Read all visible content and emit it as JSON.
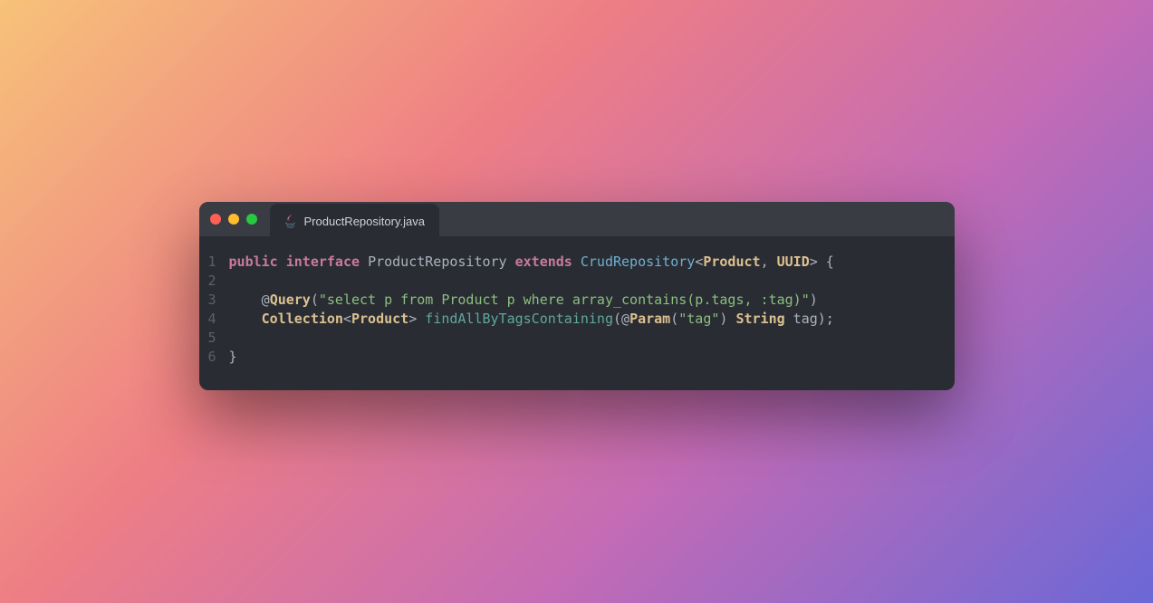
{
  "tab": {
    "filename": "ProductRepository.java"
  },
  "gutter": [
    "1",
    "2",
    "3",
    "4",
    "5",
    "6"
  ],
  "code": {
    "lines": [
      [
        {
          "c": "kw",
          "t": "public"
        },
        {
          "c": "p",
          "t": " "
        },
        {
          "c": "kw",
          "t": "interface"
        },
        {
          "c": "p",
          "t": " "
        },
        {
          "c": "p",
          "t": "ProductRepository "
        },
        {
          "c": "kw",
          "t": "extends"
        },
        {
          "c": "p",
          "t": " "
        },
        {
          "c": "cls",
          "t": "CrudRepository"
        },
        {
          "c": "p",
          "t": "<"
        },
        {
          "c": "typ",
          "t": "Product"
        },
        {
          "c": "p",
          "t": ", "
        },
        {
          "c": "typ",
          "t": "UUID"
        },
        {
          "c": "p",
          "t": "> {"
        }
      ],
      [],
      [
        {
          "c": "p",
          "t": "    @"
        },
        {
          "c": "ann",
          "t": "Query"
        },
        {
          "c": "p",
          "t": "("
        },
        {
          "c": "str",
          "t": "\"select p from Product p where array_contains(p.tags, :tag)\""
        },
        {
          "c": "p",
          "t": ")"
        }
      ],
      [
        {
          "c": "p",
          "t": "    "
        },
        {
          "c": "typ",
          "t": "Collection"
        },
        {
          "c": "p",
          "t": "<"
        },
        {
          "c": "typ",
          "t": "Product"
        },
        {
          "c": "p",
          "t": "> "
        },
        {
          "c": "fn",
          "t": "findAllByTagsContaining"
        },
        {
          "c": "p",
          "t": "(@"
        },
        {
          "c": "ann",
          "t": "Param"
        },
        {
          "c": "p",
          "t": "("
        },
        {
          "c": "str",
          "t": "\"tag\""
        },
        {
          "c": "p",
          "t": ") "
        },
        {
          "c": "typ",
          "t": "String"
        },
        {
          "c": "p",
          "t": " tag);"
        }
      ],
      [],
      [
        {
          "c": "p",
          "t": "}"
        }
      ]
    ]
  }
}
